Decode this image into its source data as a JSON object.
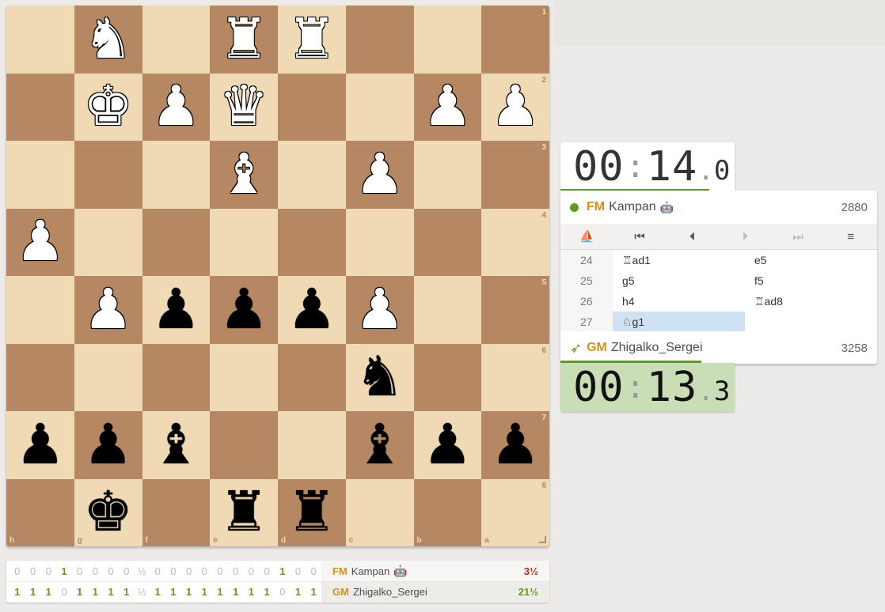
{
  "board": {
    "ranks": [
      "1",
      "2",
      "3",
      "4",
      "5",
      "6",
      "7",
      "8"
    ],
    "files": [
      "h",
      "g",
      "f",
      "e",
      "d",
      "c",
      "b",
      "a"
    ],
    "rows": [
      [
        "",
        "wN",
        "",
        "wR",
        "wR",
        "",
        "",
        ""
      ],
      [
        "",
        "wK",
        "wP",
        "wQ",
        "",
        "",
        "wP",
        "wP"
      ],
      [
        "",
        "",
        "",
        "wB",
        "",
        "wP",
        "",
        ""
      ],
      [
        "wP",
        "",
        "",
        "",
        "",
        "",
        "",
        ""
      ],
      [
        "",
        "wP",
        "bP",
        "bP",
        "bP",
        "wP",
        "",
        ""
      ],
      [
        "",
        "",
        "",
        "",
        "",
        "bN",
        "",
        ""
      ],
      [
        "bP",
        "bP",
        "bB",
        "",
        "",
        "bB",
        "bP",
        "bP"
      ],
      [
        "",
        "bK",
        "",
        "bR",
        "bR",
        "",
        "",
        ""
      ]
    ]
  },
  "top_clock": {
    "main": "00",
    "sep": ":",
    "secs": "14",
    "dot": ".",
    "tenths": "0"
  },
  "bottom_clock": {
    "main": "00",
    "sep": ":",
    "secs": "13",
    "dot": ".",
    "tenths": "3"
  },
  "top_player": {
    "title": "FM",
    "name": "Kampan",
    "bot": "🤖",
    "rating": "2880"
  },
  "bottom_player": {
    "title": "GM",
    "name": "Zhigalko_Sergei",
    "rating": "3258"
  },
  "controls": {
    "analysis_icon": "⛵",
    "first": "⏮",
    "prev": "⏴",
    "next": "⏵",
    "last": "⏭",
    "menu": "≡"
  },
  "moves": [
    {
      "num": "24",
      "white": "♖ad1",
      "black": "e5"
    },
    {
      "num": "25",
      "white": "g5",
      "black": "f5"
    },
    {
      "num": "26",
      "white": "h4",
      "black": "♖ad8"
    },
    {
      "num": "27",
      "white": "♘g1",
      "black": ""
    }
  ],
  "crosstable": {
    "row1": [
      "0",
      "0",
      "0",
      "1",
      "0",
      "0",
      "0",
      "0",
      "½",
      "0",
      "0",
      "0",
      "0",
      "0",
      "0",
      "0",
      "0",
      "1",
      "0",
      "0"
    ],
    "row2": [
      "1",
      "1",
      "1",
      "0",
      "1",
      "1",
      "1",
      "1",
      "½",
      "1",
      "1",
      "1",
      "1",
      "1",
      "1",
      "1",
      "1",
      "0",
      "1",
      "1"
    ],
    "p1": {
      "title": "FM",
      "name": "Kampan",
      "bot": "🤖",
      "score": "3½"
    },
    "p2": {
      "title": "GM",
      "name": "Zhigalko_Sergei",
      "score": "21½"
    }
  },
  "colors": {
    "accent": "#629924",
    "title": "#d59120",
    "light_square": "#f0d9b5",
    "dark_square": "#b58863"
  }
}
